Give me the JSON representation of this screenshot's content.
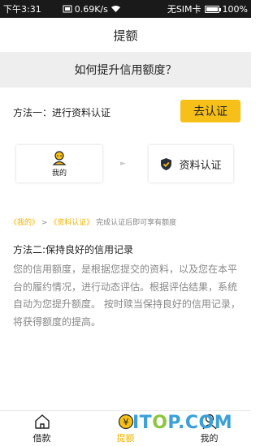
{
  "status_bar": {
    "time": "下午3:31",
    "speed": "0.69K/s",
    "carrier": "无SIM卡",
    "battery": "100%",
    "battery_level": 1.0
  },
  "header": {
    "title": "提额"
  },
  "banner": {
    "text": "如何提升信用额度？"
  },
  "method1": {
    "text": "方法一：进行资料认证",
    "button_label": "去认证"
  },
  "steps": {
    "mine_label": "我的",
    "profile_label": "资料认证"
  },
  "hint": {
    "link1": "《我的》",
    "sep": " > ",
    "link2": "《资料认证》",
    "text": " 完成认证后即可享有额度"
  },
  "method2": {
    "title": "方法二:保持良好的信用记录",
    "body": "您的信用额度，是根据您提交的资料，以及您在本平台的履约情况，进行动态评估。根据评估结果，系统自动为您提升额度。 按时赎当保持良好的信用记录，将获得额度的提高。"
  },
  "tabbar": {
    "tabs": [
      {
        "label": "借款",
        "icon": "home-icon",
        "active": false
      },
      {
        "label": "提额",
        "icon": "yen-icon",
        "active": true
      },
      {
        "label": "我的",
        "icon": "person-icon",
        "active": false
      }
    ]
  },
  "watermark": {
    "prefix": "IT",
    "o": "O",
    "rest": "P.COM"
  },
  "colors": {
    "accent": "#f6c018",
    "link": "#f0b400",
    "banner_bg": "#eeeeee",
    "status_bg": "#1a1a1a"
  }
}
